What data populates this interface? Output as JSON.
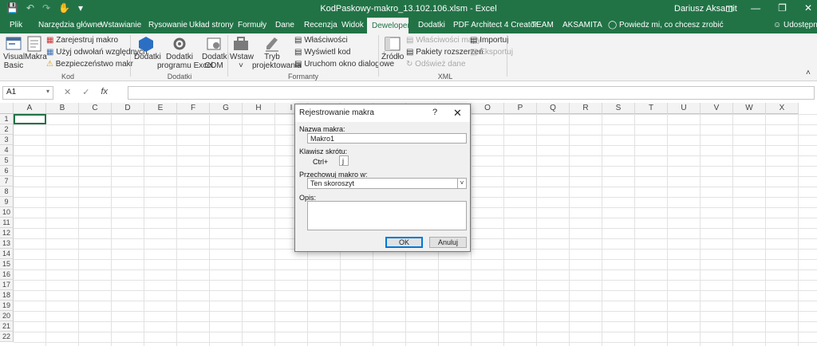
{
  "titlebar": {
    "title": "KodPaskowy-makro_13.102.106.xlsm  -  Excel",
    "user": "Dariusz Aksamit",
    "icons": [
      "save-icon",
      "undo-icon",
      "redo-icon",
      "touch-mode-icon",
      "customize-icon"
    ]
  },
  "tabs": [
    "Plik",
    "Narzędzia główne",
    "Wstawianie",
    "Rysowanie",
    "Układ strony",
    "Formuły",
    "Dane",
    "Recenzja",
    "Widok",
    "Deweloper",
    "Dodatki",
    "PDF Architect 4 Creator",
    "TEAM",
    "AKSAMITA",
    "Powiedz mi, co chcesz zrobić",
    "Udostępnij"
  ],
  "active_tab": "Deweloper",
  "ribbon": {
    "kod": {
      "group": "Kod",
      "visual_basic": [
        "Visual",
        "Basic"
      ],
      "makra": "Makra",
      "zarejestruj": "Zarejestruj makro",
      "uzyj": "Użyj odwołań względnych",
      "bezpieczenstwo": "Bezpieczeństwo makr"
    },
    "dodatki": {
      "group": "Dodatki",
      "dodatki": "Dodatki",
      "dodatki_excel": [
        "Dodatki",
        "programu Excel"
      ],
      "dodatki_com": [
        "Dodatki",
        "COM"
      ]
    },
    "formanty": {
      "group": "Formanty",
      "wstaw": "Wstaw",
      "tryb": [
        "Tryb",
        "projektowania"
      ],
      "wlasciwosci": "Właściwości",
      "wyswietl": "Wyświetl kod",
      "uruchom": "Uruchom okno dialogowe"
    },
    "xml": {
      "group": "XML",
      "zrodlo": "Źródło",
      "wlasciwosci_mapy": "Właściwości mapy",
      "pakiety": "Pakiety rozszerzeń",
      "odswiez": "Odśwież dane",
      "importuj": "Importuj",
      "eksportuj": "Eksportuj"
    }
  },
  "formula_bar": {
    "name_box": "A1",
    "fx": "fx"
  },
  "sheet": {
    "columns": [
      "A",
      "B",
      "C",
      "D",
      "E",
      "F",
      "G",
      "H",
      "I",
      "J",
      "K",
      "L",
      "M",
      "N",
      "O",
      "P",
      "Q",
      "R",
      "S",
      "T",
      "U",
      "V",
      "W",
      "X"
    ],
    "rows": [
      "1",
      "2",
      "3",
      "4",
      "5",
      "6",
      "7",
      "8",
      "9",
      "10",
      "11",
      "12",
      "13",
      "14",
      "15",
      "16",
      "17",
      "18",
      "19",
      "20",
      "21",
      "22"
    ]
  },
  "dialog": {
    "title": "Rejestrowanie makra",
    "help": "?",
    "close": "✕",
    "name_label": "Nazwa makra:",
    "name_value": "Makro1",
    "shortcut_label": "Klawisz skrótu:",
    "ctrl_label": "Ctrl+",
    "shortcut_value": "j",
    "store_label": "Przechowuj makro w:",
    "store_value": "Ten skoroszyt",
    "desc_label": "Opis:",
    "ok": "OK",
    "cancel": "Anuluj"
  },
  "colors": {
    "excel_green": "#217346",
    "ribbon_bg": "#f3f3f3"
  }
}
